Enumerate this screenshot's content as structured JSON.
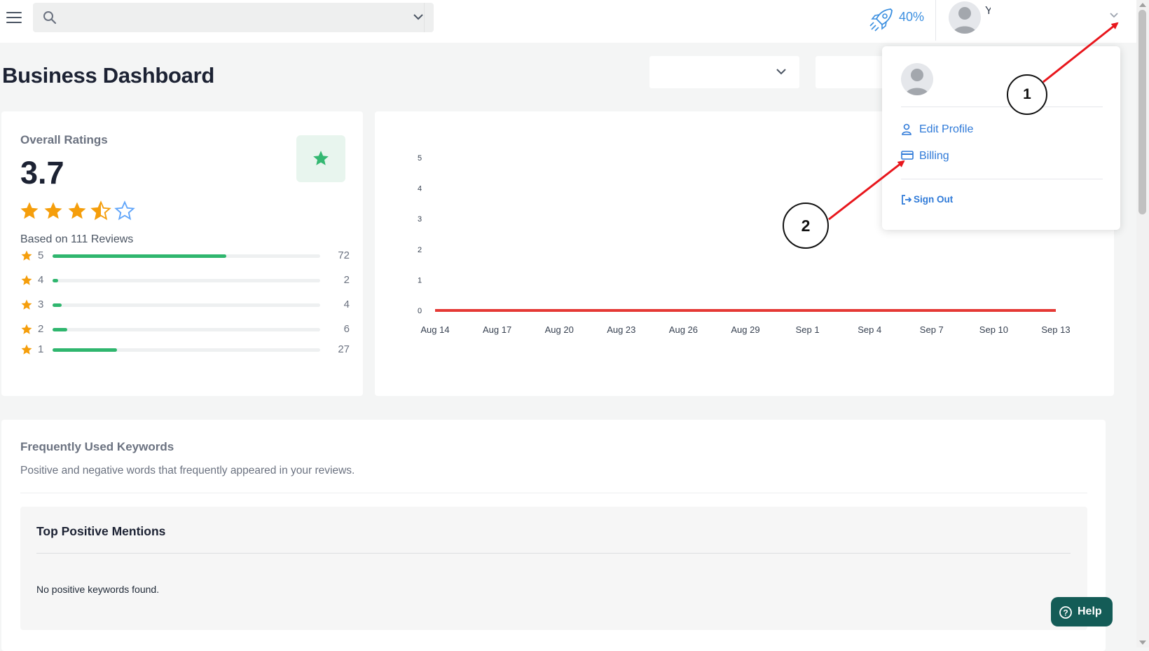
{
  "header": {
    "search_placeholder": "",
    "progress_label": "40%",
    "progress_value": 0.4,
    "username_fragment": "Y"
  },
  "page": {
    "title": "Business Dashboard"
  },
  "ratings": {
    "title": "Overall Ratings",
    "value": "3.7",
    "rating_numeric": 3.7,
    "based_on": "Based on 111 Reviews",
    "distribution": [
      {
        "stars": "5",
        "count": "72",
        "fraction": 0.65
      },
      {
        "stars": "4",
        "count": "2",
        "fraction": 0.02
      },
      {
        "stars": "3",
        "count": "4",
        "fraction": 0.035
      },
      {
        "stars": "2",
        "count": "6",
        "fraction": 0.055
      },
      {
        "stars": "1",
        "count": "27",
        "fraction": 0.24
      }
    ],
    "bar_color": "#2fb66e",
    "star_color": "#f59e0b"
  },
  "chart_data": {
    "type": "line",
    "title": "",
    "xlabel": "",
    "ylabel": "",
    "x": [
      "Aug 14",
      "Aug 17",
      "Aug 20",
      "Aug 23",
      "Aug 26",
      "Aug 29",
      "Sep 1",
      "Sep 4",
      "Sep 7",
      "Sep 10",
      "Sep 13"
    ],
    "yticks": [
      "0",
      "1",
      "2",
      "3",
      "4",
      "5"
    ],
    "ylim": [
      0,
      5
    ],
    "series": [
      {
        "values": [
          0,
          0,
          0,
          0,
          0,
          0,
          0,
          0,
          0,
          0,
          0
        ],
        "color": "#e53935"
      }
    ],
    "grid": false
  },
  "keywords": {
    "title": "Frequently Used Keywords",
    "subtitle": "Positive and negative words that frequently appeared in your reviews.",
    "positive_title": "Top Positive Mentions",
    "positive_empty": "No positive keywords found."
  },
  "user_menu": {
    "edit_profile": "Edit Profile",
    "billing": "Billing",
    "sign_out": "Sign Out",
    "link_color": "#2f7ad8"
  },
  "annotations": {
    "step1": "1",
    "step2": "2",
    "arrow_color": "#e8161c"
  },
  "help": {
    "label": "Help"
  }
}
